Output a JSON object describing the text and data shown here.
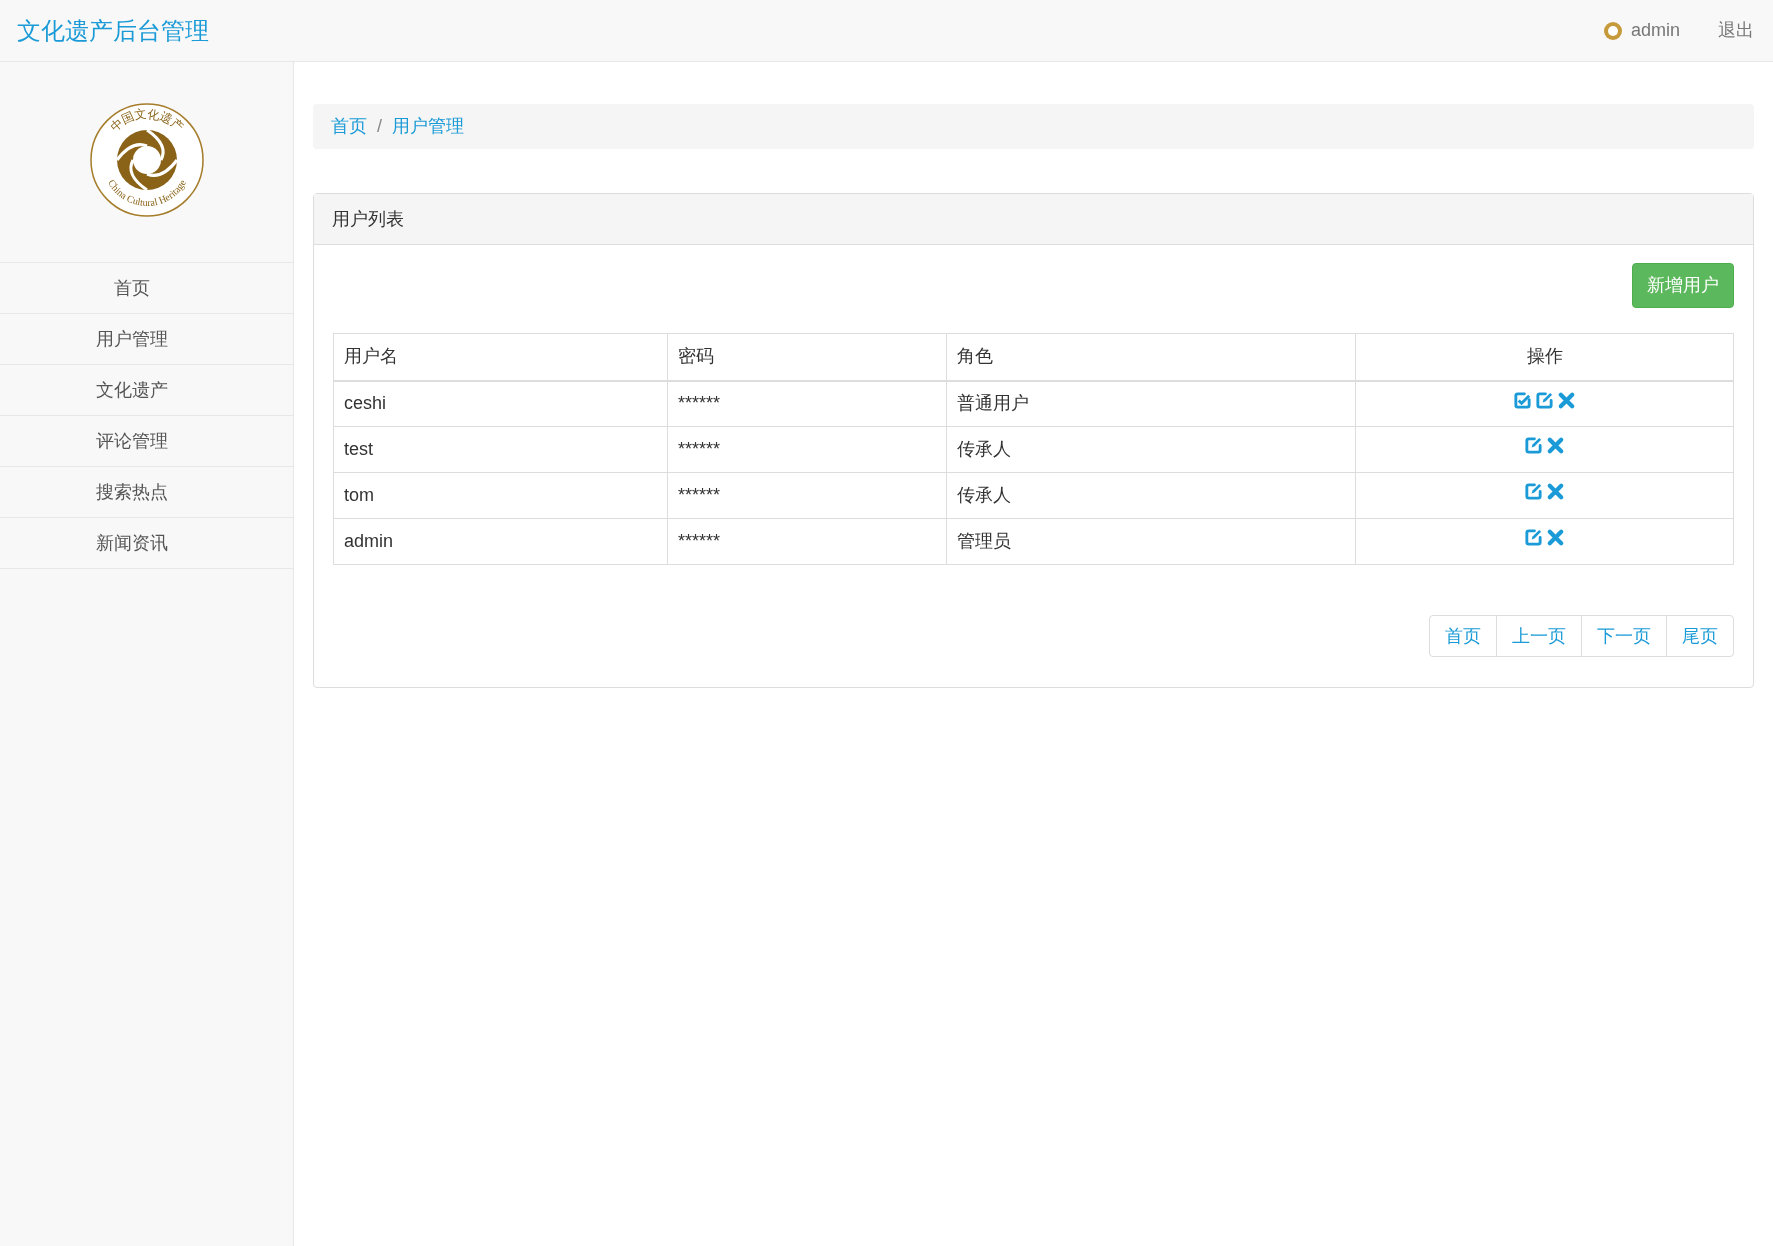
{
  "navbar": {
    "brand": "文化遗产后台管理",
    "user": "admin",
    "logout": "退出"
  },
  "sidebar": {
    "logo": {
      "text_top": "中国文化遗产",
      "text_bottom": "China Cultural Heritage"
    },
    "items": [
      {
        "label": "首页"
      },
      {
        "label": "用户管理"
      },
      {
        "label": "文化遗产"
      },
      {
        "label": "评论管理"
      },
      {
        "label": "搜索热点"
      },
      {
        "label": "新闻资讯"
      }
    ]
  },
  "breadcrumb": {
    "separator": "/",
    "items": [
      "首页",
      "用户管理"
    ]
  },
  "panel": {
    "title": "用户列表",
    "add_button": "新增用户",
    "table": {
      "columns": [
        "用户名",
        "密码",
        "角色",
        "操作"
      ],
      "rows": [
        {
          "cells": [
            "ceshi",
            "******",
            "普通用户"
          ],
          "actions": [
            {
              "kind": "check-edit"
            },
            {
              "kind": "edit"
            },
            {
              "kind": "delete"
            }
          ]
        },
        {
          "cells": [
            "test",
            "******",
            "传承人"
          ],
          "actions": [
            {
              "kind": "edit"
            },
            {
              "kind": "delete"
            }
          ]
        },
        {
          "cells": [
            "tom",
            "******",
            "传承人"
          ],
          "actions": [
            {
              "kind": "edit"
            },
            {
              "kind": "delete"
            }
          ]
        },
        {
          "cells": [
            "admin",
            "******",
            "管理员"
          ],
          "actions": [
            {
              "kind": "edit"
            },
            {
              "kind": "delete"
            }
          ]
        }
      ]
    },
    "pagination": [
      "首页",
      "上一页",
      "下一页",
      "尾页"
    ]
  }
}
